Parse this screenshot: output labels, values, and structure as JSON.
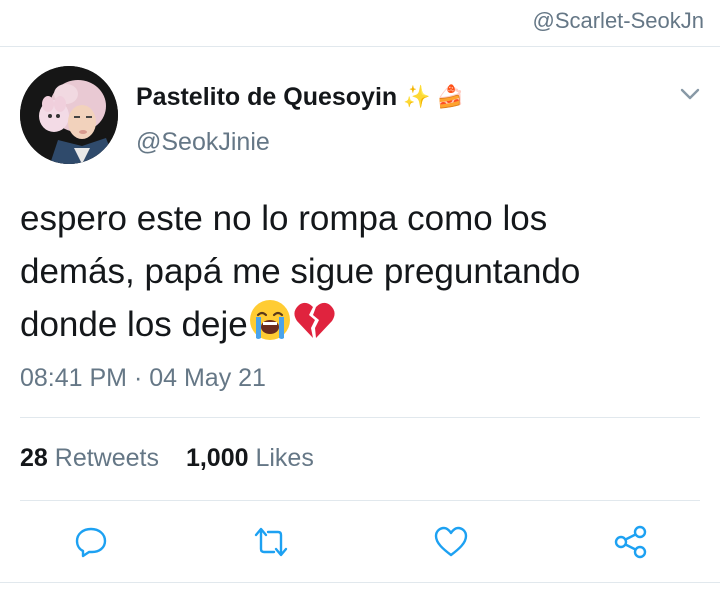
{
  "watermark": "@Scarlet-SeokJn",
  "tweet": {
    "display_name": "Pastelito de Quesoyin",
    "name_emojis": [
      "✨",
      "🍰"
    ],
    "handle": "@SeokJinie",
    "text_lines": [
      "espero este no lo rompa como los",
      "demás, papá me sigue preguntando",
      "donde los deje"
    ],
    "text_emojis": [
      "loudly-crying-face",
      "broken-heart"
    ],
    "timestamp": "08:41 PM · 04 May 21",
    "stats": {
      "retweets_count": "28",
      "retweets_label": "Retweets",
      "likes_count": "1,000",
      "likes_label": "Likes"
    }
  },
  "icons": {
    "more_options": "chevron-down-icon",
    "actions": [
      "reply-icon",
      "retweet-icon",
      "like-icon",
      "share-icon"
    ]
  },
  "colors": {
    "text_primary": "#14171a",
    "text_secondary": "#657786",
    "icon_blue": "#1da1f2",
    "divider": "#e1e8ed"
  }
}
